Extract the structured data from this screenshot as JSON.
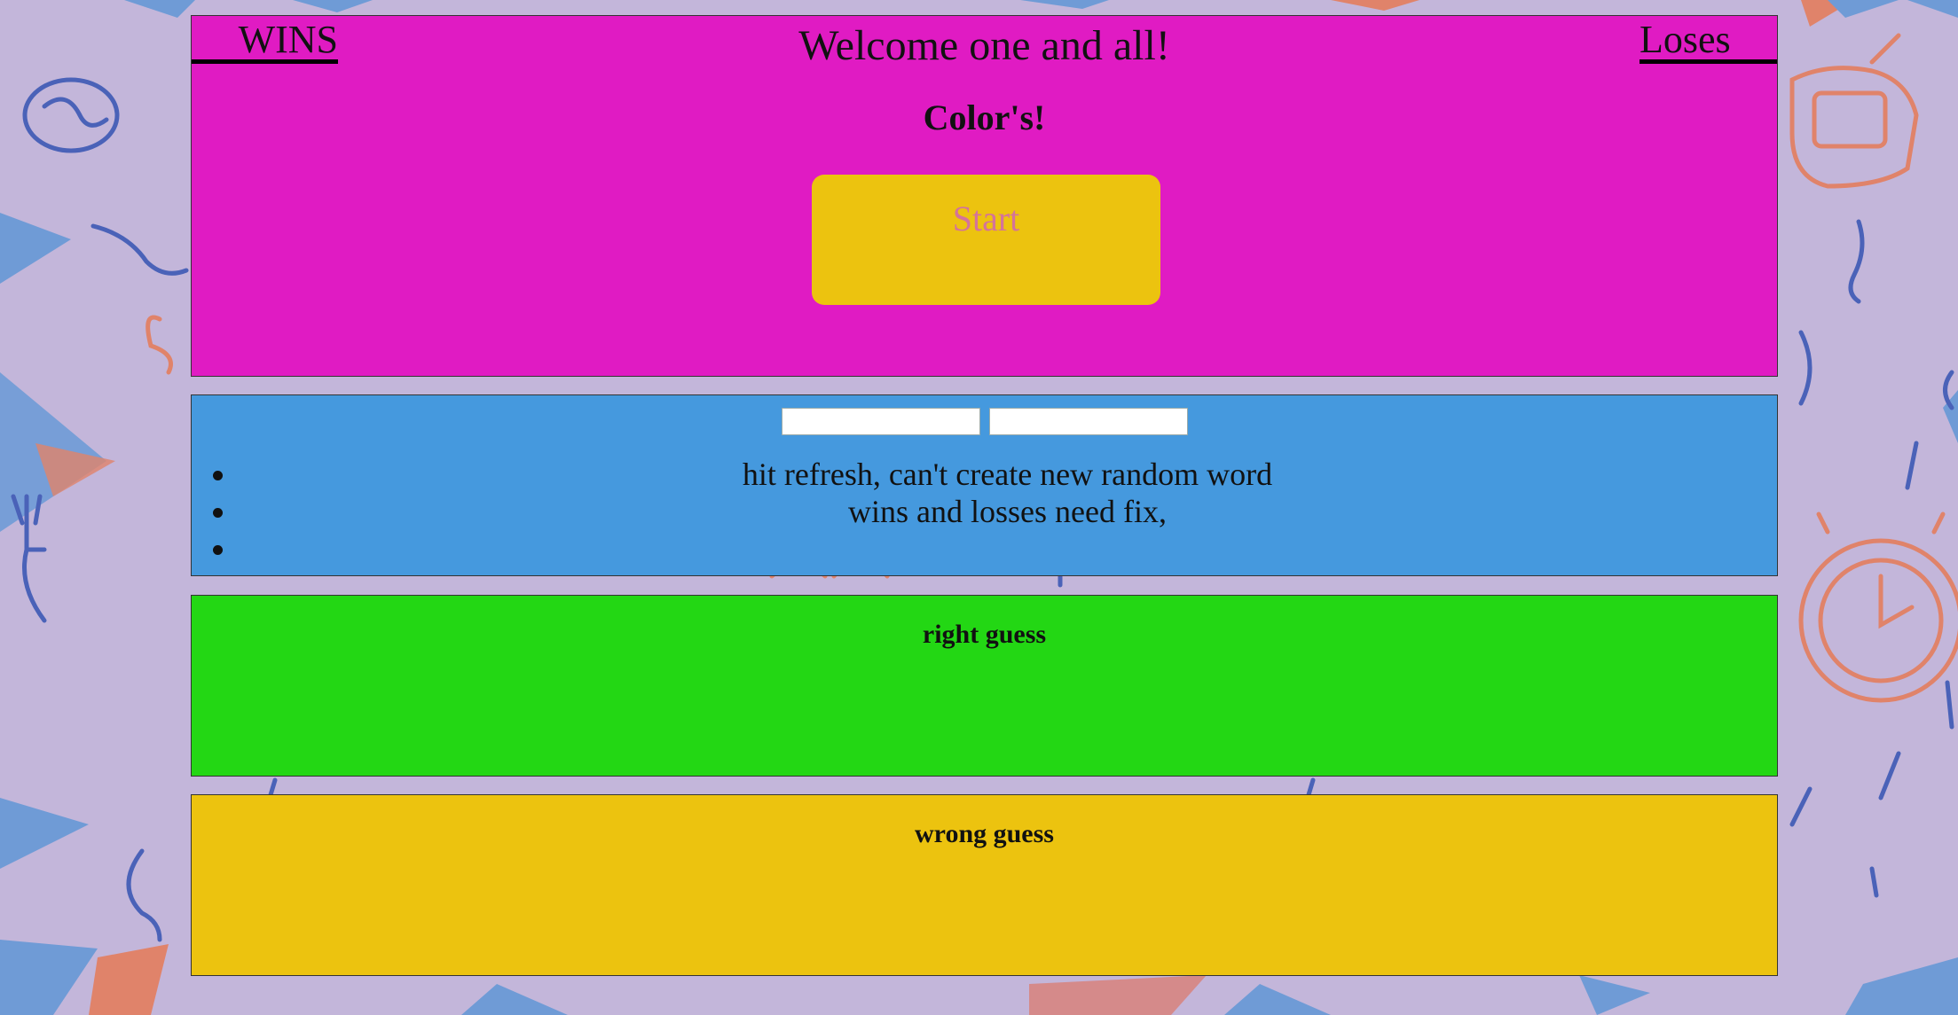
{
  "header": {
    "wins_label": "WINS",
    "losses_label": "Loses",
    "welcome": "Welcome one and all!",
    "game_title": "Color's!",
    "start_button": "Start"
  },
  "notes": {
    "items": [
      "hit refresh, can't create new random word",
      "wins and losses need fix,",
      ""
    ]
  },
  "right_section": {
    "title": "right guess"
  },
  "wrong_section": {
    "title": "wrong guess"
  },
  "colors": {
    "header_bg": "#e01bc3",
    "notes_bg": "#4599de",
    "right_bg": "#23d714",
    "wrong_bg": "#ecc30f",
    "start_bg": "#ecc30f",
    "start_text": "#d4739a",
    "page_bg": "#c3b6da"
  }
}
